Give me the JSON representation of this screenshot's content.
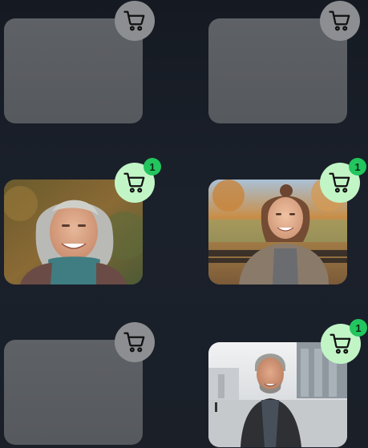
{
  "colors": {
    "placeholder": "#5a5d62",
    "cart_inactive": "#8c8e91",
    "cart_active": "#c2f5c6",
    "badge": "#23c55e"
  },
  "items": [
    {
      "image": "placeholder",
      "in_cart": false,
      "cart_count": ""
    },
    {
      "image": "placeholder",
      "in_cart": false,
      "cart_count": ""
    },
    {
      "image": "photo-older-woman",
      "in_cart": true,
      "cart_count": "1"
    },
    {
      "image": "photo-young-woman-park",
      "in_cart": true,
      "cart_count": "1"
    },
    {
      "image": "placeholder",
      "in_cart": false,
      "cart_count": ""
    },
    {
      "image": "photo-man-city-street",
      "in_cart": true,
      "cart_count": "1"
    }
  ]
}
